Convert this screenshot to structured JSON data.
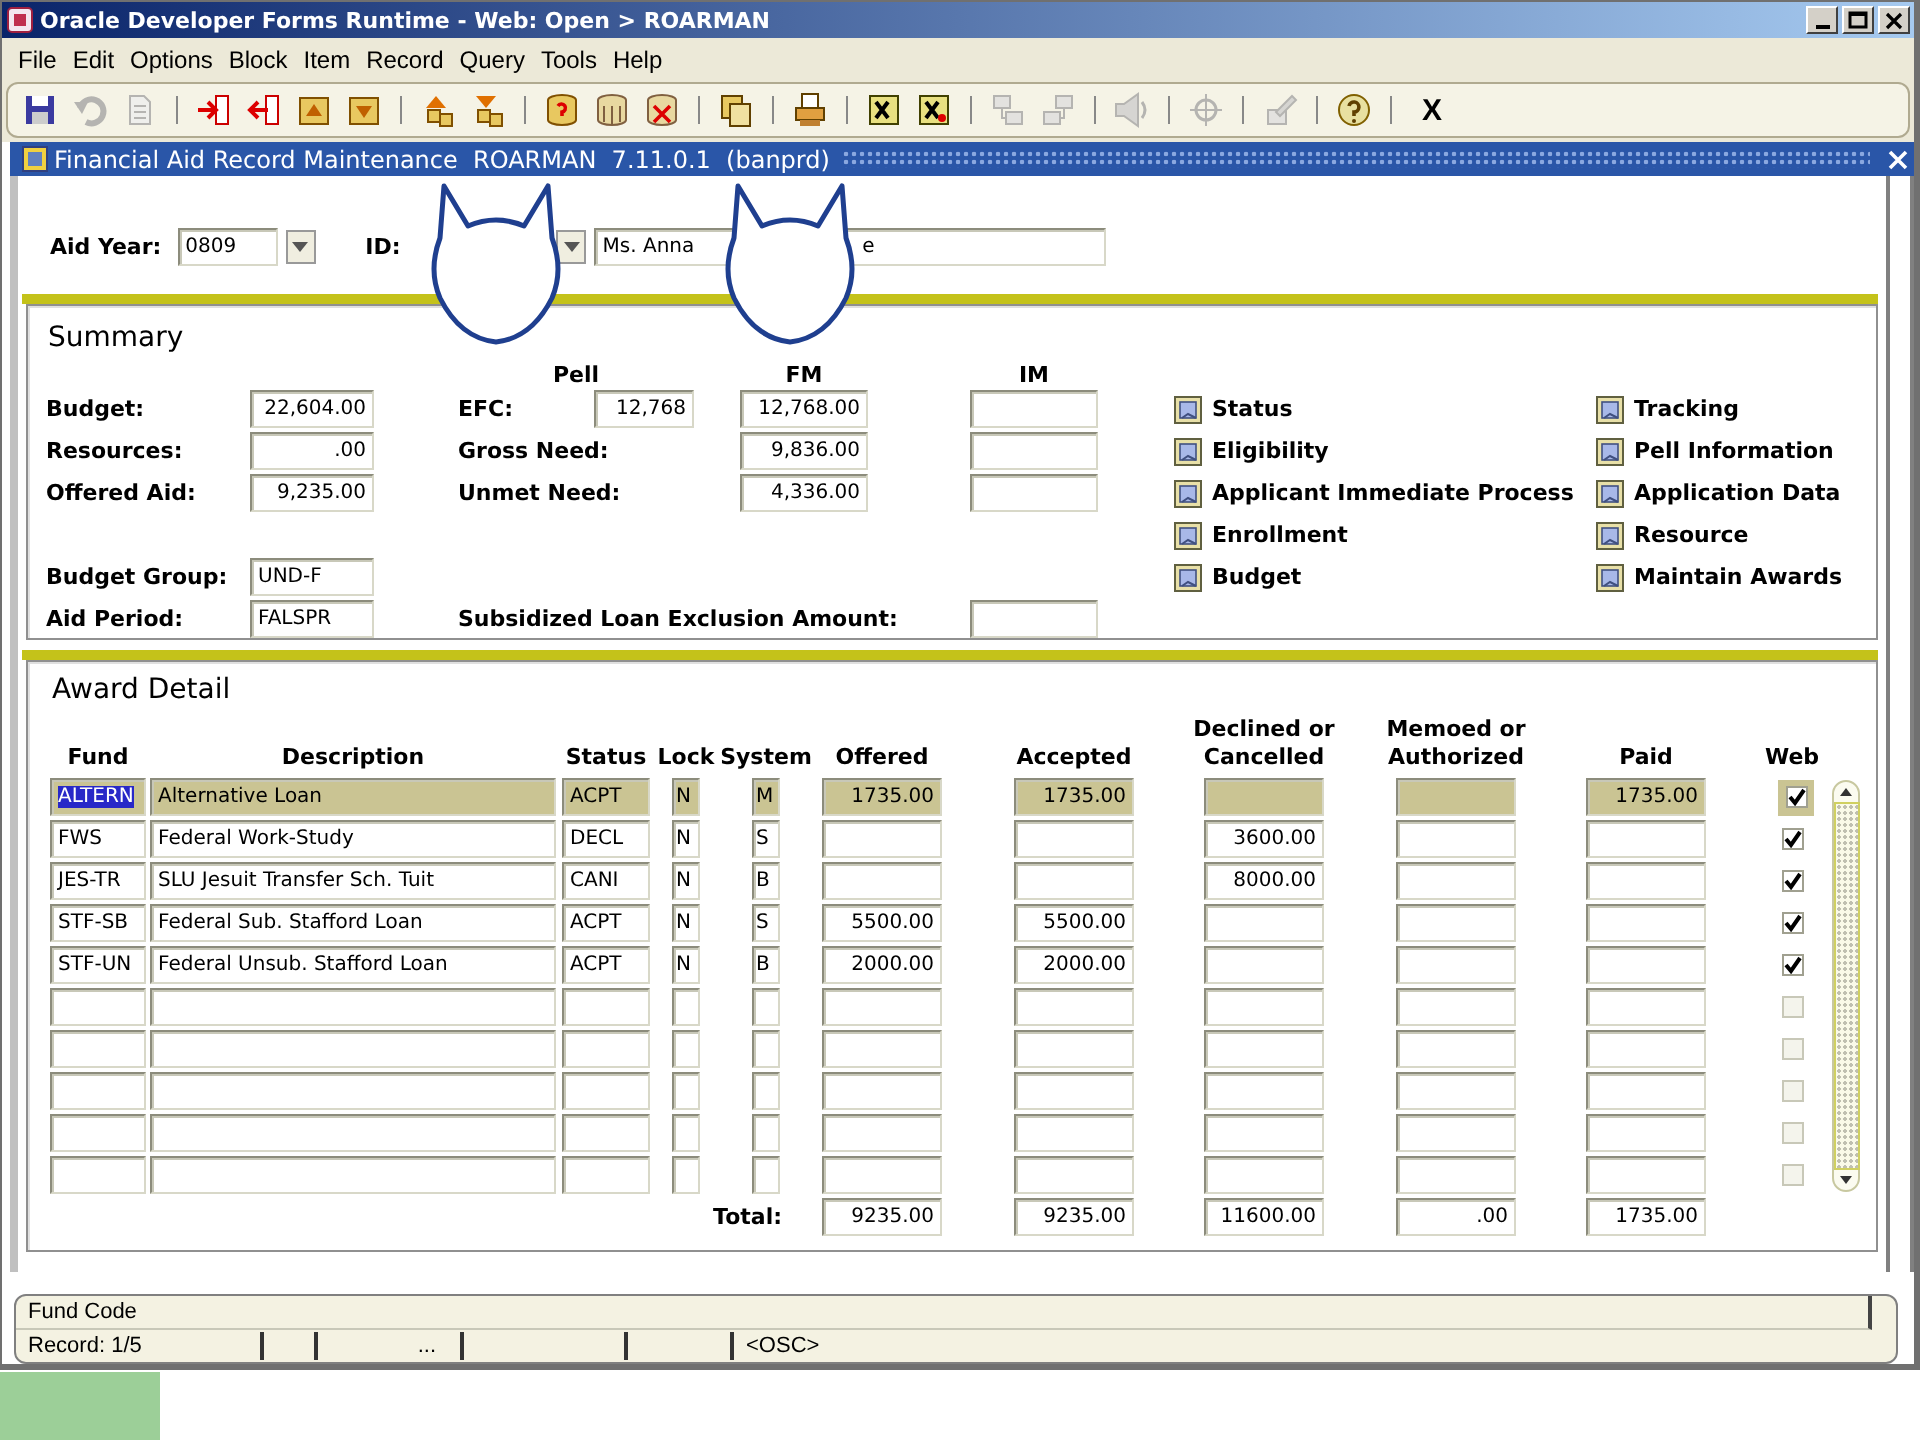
{
  "window": {
    "title": "Oracle Developer Forms Runtime - Web:  Open > ROARMAN"
  },
  "menu": [
    "File",
    "Edit",
    "Options",
    "Block",
    "Item",
    "Record",
    "Query",
    "Tools",
    "Help"
  ],
  "toolbar": {
    "groups": [
      [
        {
          "disabled": false
        },
        {
          "disabled": true
        },
        {
          "disabled": true
        }
      ],
      [
        {
          "disabled": false
        },
        {
          "disabled": false
        },
        {
          "disabled": false
        },
        {
          "disabled": false
        }
      ],
      [
        {
          "disabled": false
        },
        {
          "disabled": false
        }
      ],
      [
        {
          "disabled": false
        },
        {
          "disabled": false
        },
        {
          "disabled": false
        }
      ],
      [
        {
          "disabled": false
        }
      ],
      [
        {
          "disabled": false
        }
      ],
      [
        {
          "disabled": false
        },
        {
          "disabled": false
        }
      ],
      [
        {
          "disabled": true
        },
        {
          "disabled": true
        }
      ],
      [
        {
          "disabled": true
        }
      ],
      [
        {
          "disabled": true
        }
      ],
      [
        {
          "disabled": true
        }
      ],
      [
        {
          "disabled": false
        }
      ]
    ],
    "exit_label": "X"
  },
  "form": {
    "title": "Financial Aid Record Maintenance  ROARMAN  7.11.0.1  (banprd)",
    "key_block": {
      "aid_year_label": "Aid Year:",
      "aid_year": "0809",
      "id_label": "ID:",
      "name_start": "Ms. Anna",
      "name_end": "e"
    },
    "overlays": [
      {
        "kind": "mascot"
      },
      {
        "kind": "mascot"
      }
    ],
    "summary": {
      "title": "Summary",
      "columns": [
        "Pell",
        "FM",
        "IM"
      ],
      "left": [
        {
          "label": "Budget:",
          "value": "22,604.00"
        },
        {
          "label": "Resources:",
          "value": ".00"
        },
        {
          "label": "Offered Aid:",
          "value": "9,235.00"
        }
      ],
      "need": [
        {
          "label": "EFC:",
          "pell": "12,768",
          "fm": "12,768.00"
        },
        {
          "label": "Gross Need:",
          "fm": "9,836.00"
        },
        {
          "label": "Unmet Need:",
          "fm": "4,336.00"
        }
      ],
      "period": [
        {
          "label": "Budget Group:",
          "value": "UND-F"
        },
        {
          "label": "Aid Period:",
          "value": "FALSPR"
        }
      ],
      "exclusion_label": "Subsidized Loan Exclusion Amount:",
      "options": [
        [
          "Status",
          "Eligibility",
          "Applicant Immediate Process",
          "Enrollment",
          "Budget"
        ],
        [
          "Tracking",
          "Pell Information",
          "Application Data",
          "Resource",
          "Maintain Awards"
        ]
      ]
    },
    "award": {
      "title": "Award Detail",
      "columns": [
        "Fund",
        "Description",
        "Status",
        "Lock",
        "System",
        "Offered",
        "Accepted",
        "Declined or Cancelled",
        "Memoed or Authorized",
        "Paid",
        "Web"
      ],
      "rows": [
        {
          "selected": true,
          "fund": "ALTERN",
          "description": "Alternative Loan",
          "status": "ACPT",
          "lock": "N",
          "system": "M",
          "offered": "1735.00",
          "accepted": "1735.00",
          "paid": "1735.00",
          "web": true
        },
        {
          "selected": false,
          "fund": "FWS",
          "description": "Federal Work-Study",
          "status": "DECL",
          "lock": "N",
          "system": "S",
          "declined": "3600.00",
          "web": true
        },
        {
          "selected": false,
          "fund": "JES-TR",
          "description": "SLU Jesuit Transfer Sch. Tuit",
          "status": "CANI",
          "lock": "N",
          "system": "B",
          "declined": "8000.00",
          "web": true
        },
        {
          "selected": false,
          "fund": "STF-SB",
          "description": "Federal Sub. Stafford Loan",
          "status": "ACPT",
          "lock": "N",
          "system": "S",
          "offered": "5500.00",
          "accepted": "5500.00",
          "web": true
        },
        {
          "selected": false,
          "fund": "STF-UN",
          "description": "Federal Unsub. Stafford Loan",
          "status": "ACPT",
          "lock": "N",
          "system": "B",
          "offered": "2000.00",
          "accepted": "2000.00",
          "web": true
        },
        {
          "selected": false,
          "web": false
        },
        {
          "selected": false,
          "web": false
        },
        {
          "selected": false,
          "web": false
        },
        {
          "selected": false,
          "web": false
        },
        {
          "selected": false,
          "web": false
        }
      ],
      "total_label": "Total:",
      "totals": {
        "offered": "9235.00",
        "accepted": "9235.00",
        "declined": "11600.00",
        "memoed": ".00",
        "paid": "1735.00"
      }
    },
    "status_bar": {
      "message": "Fund Code",
      "record": "Record: 1/5",
      "count": "...",
      "mode": "<OSC>"
    }
  }
}
